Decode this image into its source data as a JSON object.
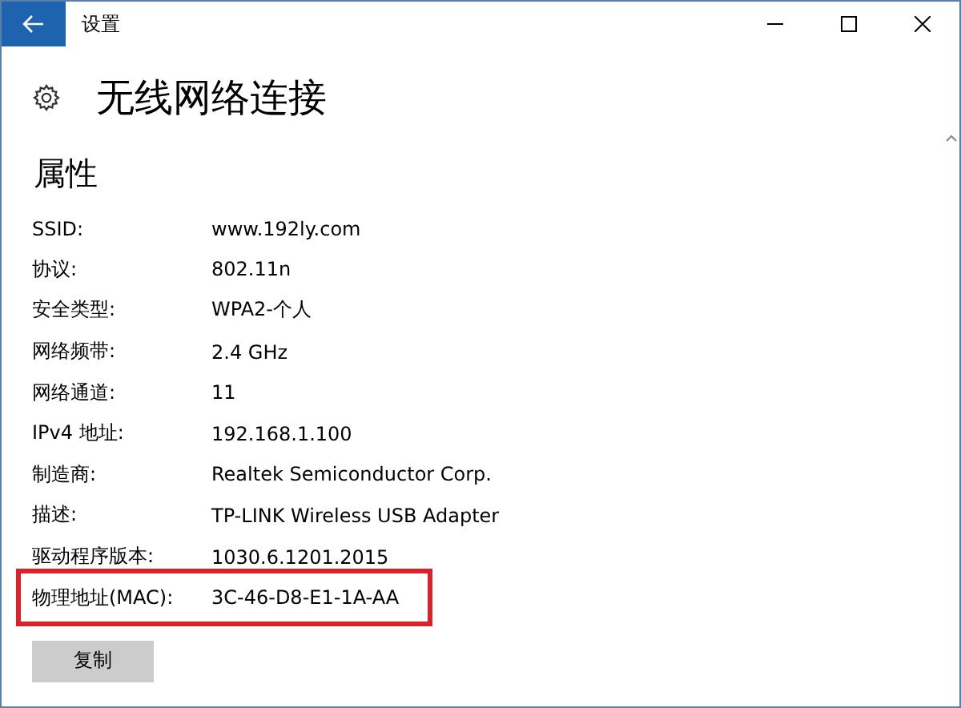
{
  "window": {
    "title": "设置"
  },
  "page": {
    "title": "无线网络连接"
  },
  "section": {
    "title": "属性"
  },
  "properties": [
    {
      "label": "SSID:",
      "value": "www.192ly.com",
      "highlighted": false
    },
    {
      "label": "协议:",
      "value": "802.11n",
      "highlighted": false
    },
    {
      "label": "安全类型:",
      "value": "WPA2-个人",
      "highlighted": false
    },
    {
      "label": "网络频带:",
      "value": "2.4 GHz",
      "highlighted": false
    },
    {
      "label": "网络通道:",
      "value": "11",
      "highlighted": false
    },
    {
      "label": "IPv4 地址:",
      "value": "192.168.1.100",
      "highlighted": false
    },
    {
      "label": "制造商:",
      "value": "Realtek Semiconductor Corp.",
      "highlighted": false
    },
    {
      "label": "描述:",
      "value": "TP-LINK Wireless USB Adapter",
      "highlighted": false
    },
    {
      "label": "驱动程序版本:",
      "value": "1030.6.1201.2015",
      "highlighted": false
    },
    {
      "label": "物理地址(MAC):",
      "value": "3C-46-D8-E1-1A-AA",
      "highlighted": true
    }
  ],
  "buttons": [
    "复制"
  ]
}
